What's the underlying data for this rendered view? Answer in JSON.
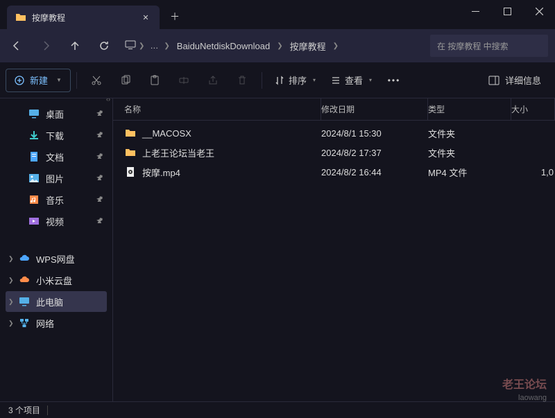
{
  "tab": {
    "title": "按摩教程"
  },
  "window_controls": {
    "min": "minimize",
    "max": "maximize",
    "close": "close"
  },
  "breadcrumb": {
    "monitor_icon": "monitor-icon",
    "ellipsis": "…",
    "seg1": "BaiduNetdiskDownload",
    "seg2": "按摩教程"
  },
  "search": {
    "placeholder": "在 按摩教程 中搜索"
  },
  "toolbar": {
    "new_label": "新建",
    "sort_label": "排序",
    "view_label": "查看",
    "details_label": "详细信息"
  },
  "sidebar": {
    "quick": [
      {
        "label": "桌面",
        "icon": "desktop",
        "color": "icon-lblue"
      },
      {
        "label": "下载",
        "icon": "download",
        "color": "icon-teal"
      },
      {
        "label": "文档",
        "icon": "document",
        "color": "icon-blue"
      },
      {
        "label": "图片",
        "icon": "picture",
        "color": "icon-lblue"
      },
      {
        "label": "音乐",
        "icon": "music",
        "color": "icon-orange"
      },
      {
        "label": "视频",
        "icon": "video",
        "color": "icon-purple"
      }
    ],
    "drives": [
      {
        "label": "WPS网盘",
        "icon": "cloud",
        "color": "icon-blue",
        "expandable": true
      },
      {
        "label": "小米云盘",
        "icon": "cloud",
        "color": "icon-orange",
        "expandable": true
      },
      {
        "label": "此电脑",
        "icon": "pc",
        "color": "icon-lblue",
        "expandable": true,
        "selected": true
      },
      {
        "label": "网络",
        "icon": "network",
        "color": "icon-lblue",
        "expandable": true
      }
    ]
  },
  "columns": {
    "name": "名称",
    "date": "修改日期",
    "type": "类型",
    "size": "大小"
  },
  "files": [
    {
      "name": "__MACOSX",
      "date": "2024/8/1 15:30",
      "type": "文件夹",
      "size": "",
      "icon": "folder"
    },
    {
      "name": "上老王论坛当老王",
      "date": "2024/8/2 17:37",
      "type": "文件夹",
      "size": "",
      "icon": "folder"
    },
    {
      "name": "按摩.mp4",
      "date": "2024/8/2 16:44",
      "type": "MP4 文件",
      "size": "1,0",
      "icon": "video-file"
    }
  ],
  "status": {
    "count": "3 个项目"
  },
  "watermark": {
    "line1": "老王论坛",
    "line2": "laowang"
  }
}
